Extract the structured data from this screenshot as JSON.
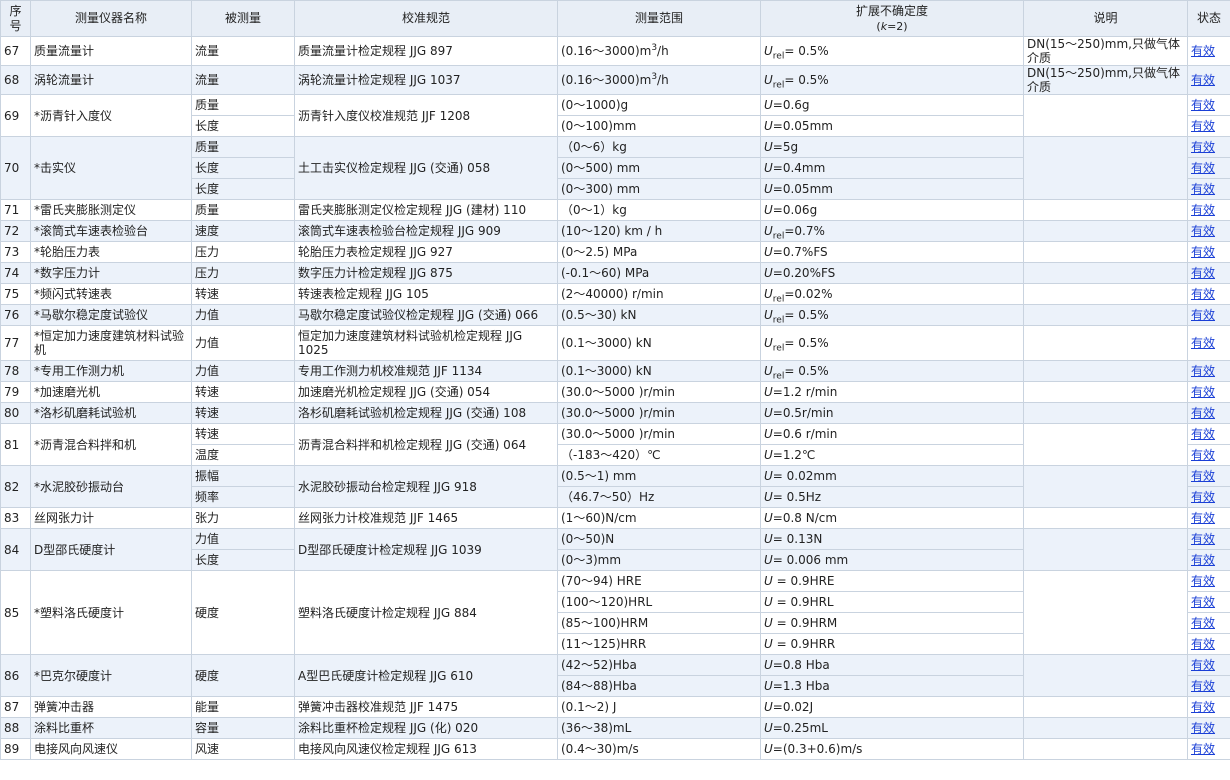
{
  "headers": {
    "no": "序号",
    "name": "测量仪器名称",
    "measurand": "被测量",
    "spec": "校准规范",
    "range": "测量范围",
    "uncertainty": "扩展不确定度",
    "k_prefix": "(",
    "k_symbol": "k",
    "k_suffix": "=2)",
    "note": "说明",
    "status": "状态"
  },
  "unc": {
    "U": "U",
    "rel": "rel"
  },
  "status_label": "有效",
  "rows": [
    {
      "no": "67",
      "name": "质量流量计",
      "spec": "质量流量计检定规程 JJG 897",
      "note": "DN(15～250)mm,只做气体介质",
      "sub": [
        {
          "measurand": "流量",
          "range": "(0.16～3000)m",
          "range_sup": "3",
          "range_tail": "/h",
          "u_rel": true,
          "u_text": "= 0.5%"
        }
      ]
    },
    {
      "no": "68",
      "name": "涡轮流量计",
      "spec": "涡轮流量计检定规程 JJG 1037",
      "note": "DN(15～250)mm,只做气体介质",
      "sub": [
        {
          "measurand": "流量",
          "range": "(0.16～3000)m",
          "range_sup": "3",
          "range_tail": "/h",
          "u_rel": true,
          "u_text": "= 0.5%"
        }
      ]
    },
    {
      "no": "69",
      "name": "*沥青针入度仪",
      "spec": "沥青针入度仪校准规范 JJF 1208",
      "note": "",
      "sub": [
        {
          "measurand": "质量",
          "range": "(0～1000)g",
          "u_text": "=0.6g"
        },
        {
          "measurand": "长度",
          "range": "(0～100)mm",
          "u_text": "=0.05mm"
        }
      ]
    },
    {
      "no": "70",
      "name": "*击实仪",
      "spec": "土工击实仪检定规程 JJG (交通) 058",
      "note": "",
      "sub": [
        {
          "measurand": "质量",
          "range": "（0～6）kg",
          "u_text": "=5g"
        },
        {
          "measurand": "长度",
          "range": "(0～500) mm",
          "u_text": "=0.4mm"
        },
        {
          "measurand": "长度",
          "range": "(0～300) mm",
          "u_text": "=0.05mm"
        }
      ]
    },
    {
      "no": "71",
      "name": "*雷氏夹膨胀测定仪",
      "spec": "雷氏夹膨胀测定仪检定规程 JJG (建材) 110",
      "note": "",
      "sub": [
        {
          "measurand": "质量",
          "range": "（0～1）kg",
          "u_text": "=0.06g"
        }
      ]
    },
    {
      "no": "72",
      "name": "*滚筒式车速表检验台",
      "spec": "滚筒式车速表检验台检定规程 JJG 909",
      "note": "",
      "sub": [
        {
          "measurand": "速度",
          "range": "(10～120) km / h",
          "u_rel": true,
          "u_text": "=0.7%"
        }
      ]
    },
    {
      "no": "73",
      "name": "*轮胎压力表",
      "spec": "轮胎压力表检定规程 JJG 927",
      "note": "",
      "sub": [
        {
          "measurand": "压力",
          "range": "(0～2.5) MPa",
          "u_text": "=0.7%FS"
        }
      ]
    },
    {
      "no": "74",
      "name": "*数字压力计",
      "spec": "数字压力计检定规程 JJG 875",
      "note": "",
      "sub": [
        {
          "measurand": "压力",
          "range": "(-0.1～60) MPa",
          "u_text": "=0.20%FS"
        }
      ]
    },
    {
      "no": "75",
      "name": "*频闪式转速表",
      "spec": "转速表检定规程 JJG 105",
      "note": "",
      "sub": [
        {
          "measurand": "转速",
          "range": "(2～40000) r/min",
          "u_rel": true,
          "u_text": "=0.02%"
        }
      ]
    },
    {
      "no": "76",
      "name": "*马歇尔稳定度试验仪",
      "spec": "马歇尔稳定度试验仪检定规程 JJG (交通) 066",
      "note": "",
      "sub": [
        {
          "measurand": "力值",
          "range": "(0.5～30) kN",
          "u_rel": true,
          "u_text": "= 0.5%"
        }
      ]
    },
    {
      "no": "77",
      "name": "*恒定加力速度建筑材料试验机",
      "spec": "恒定加力速度建筑材料试验机检定规程 JJG 1025",
      "note": "",
      "tall": true,
      "sub": [
        {
          "measurand": "力值",
          "range": "(0.1～3000) kN",
          "u_rel": true,
          "u_text": "= 0.5%"
        }
      ]
    },
    {
      "no": "78",
      "name": "*专用工作测力机",
      "spec": "专用工作测力机校准规范 JJF 1134",
      "note": "",
      "sub": [
        {
          "measurand": "力值",
          "range": "(0.1～3000) kN",
          "u_rel": true,
          "u_text": "= 0.5%"
        }
      ]
    },
    {
      "no": "79",
      "name": "*加速磨光机",
      "spec": "加速磨光机检定规程 JJG (交通) 054",
      "note": "",
      "sub": [
        {
          "measurand": "转速",
          "range": "(30.0～5000 )r/min",
          "u_text": "=1.2 r/min"
        }
      ]
    },
    {
      "no": "80",
      "name": "*洛杉矶磨耗试验机",
      "spec": "洛杉矶磨耗试验机检定规程 JJG (交通) 108",
      "note": "",
      "sub": [
        {
          "measurand": "转速",
          "range": "(30.0～5000 )r/min",
          "u_text": "=0.5r/min"
        }
      ]
    },
    {
      "no": "81",
      "name": "*沥青混合料拌和机",
      "spec": "沥青混合料拌和机检定规程 JJG (交通) 064",
      "note": "",
      "sub": [
        {
          "measurand": "转速",
          "range": "(30.0～5000 )r/min",
          "u_text": "=0.6 r/min"
        },
        {
          "measurand": "温度",
          "range": "（-183～420）℃",
          "u_text": "=1.2℃"
        }
      ]
    },
    {
      "no": "82",
      "name": "*水泥胶砂振动台",
      "spec": "水泥胶砂振动台检定规程 JJG 918",
      "note": "",
      "sub": [
        {
          "measurand": "振幅",
          "range": "(0.5～1) mm",
          "u_text": "= 0.02mm"
        },
        {
          "measurand": "频率",
          "range": "（46.7～50）Hz",
          "u_text": "= 0.5Hz"
        }
      ]
    },
    {
      "no": "83",
      "name": "丝网张力计",
      "spec": "丝网张力计校准规范 JJF 1465",
      "note": "",
      "sub": [
        {
          "measurand": "张力",
          "range": "(1～60)N/cm",
          "u_text": "=0.8 N/cm"
        }
      ]
    },
    {
      "no": "84",
      "name": "D型邵氏硬度计",
      "spec": "D型邵氏硬度计检定规程 JJG 1039",
      "note": "",
      "sub": [
        {
          "measurand": "力值",
          "range": "(0～50)N",
          "u_text": "= 0.13N"
        },
        {
          "measurand": "长度",
          "range": "(0～3)mm",
          "u_text": "= 0.006 mm"
        }
      ]
    },
    {
      "no": "85",
      "name": "*塑料洛氏硬度计",
      "spec": "塑料洛氏硬度计检定规程 JJG 884",
      "note": "",
      "merge_measurand": true,
      "sub": [
        {
          "measurand": "硬度",
          "range": "(70～94) HRE",
          "u_text": " = 0.9HRE"
        },
        {
          "measurand": "",
          "range": "(100～120)HRL",
          "u_text": " = 0.9HRL"
        },
        {
          "measurand": "",
          "range": "(85～100)HRM",
          "u_text": " = 0.9HRM"
        },
        {
          "measurand": "",
          "range": "(11～125)HRR",
          "u_text": " = 0.9HRR"
        }
      ]
    },
    {
      "no": "86",
      "name": "*巴克尔硬度计",
      "spec": "A型巴氏硬度计检定规程 JJG 610",
      "note": "",
      "merge_measurand": true,
      "sub": [
        {
          "measurand": "硬度",
          "range": "(42～52)Hba",
          "u_text": "=0.8 Hba"
        },
        {
          "measurand": "",
          "range": "(84～88)Hba",
          "u_text": "=1.3 Hba"
        }
      ]
    },
    {
      "no": "87",
      "name": "弹簧冲击器",
      "spec": "弹簧冲击器校准规范 JJF 1475",
      "note": "",
      "sub": [
        {
          "measurand": "能量",
          "range": "(0.1～2) J",
          "u_text": "=0.02J"
        }
      ]
    },
    {
      "no": "88",
      "name": "涂料比重杯",
      "spec": "涂料比重杯检定规程 JJG (化) 020",
      "note": "",
      "sub": [
        {
          "measurand": "容量",
          "range": "(36～38)mL",
          "u_text": "=0.25mL"
        }
      ]
    },
    {
      "no": "89",
      "name": "电接风向风速仪",
      "spec": "电接风向风速仪检定规程 JJG 613",
      "note": "",
      "sub": [
        {
          "measurand": "风速",
          "range": "(0.4～30)m/s",
          "u_text": "=(0.3+0.6)m/s"
        }
      ]
    }
  ]
}
